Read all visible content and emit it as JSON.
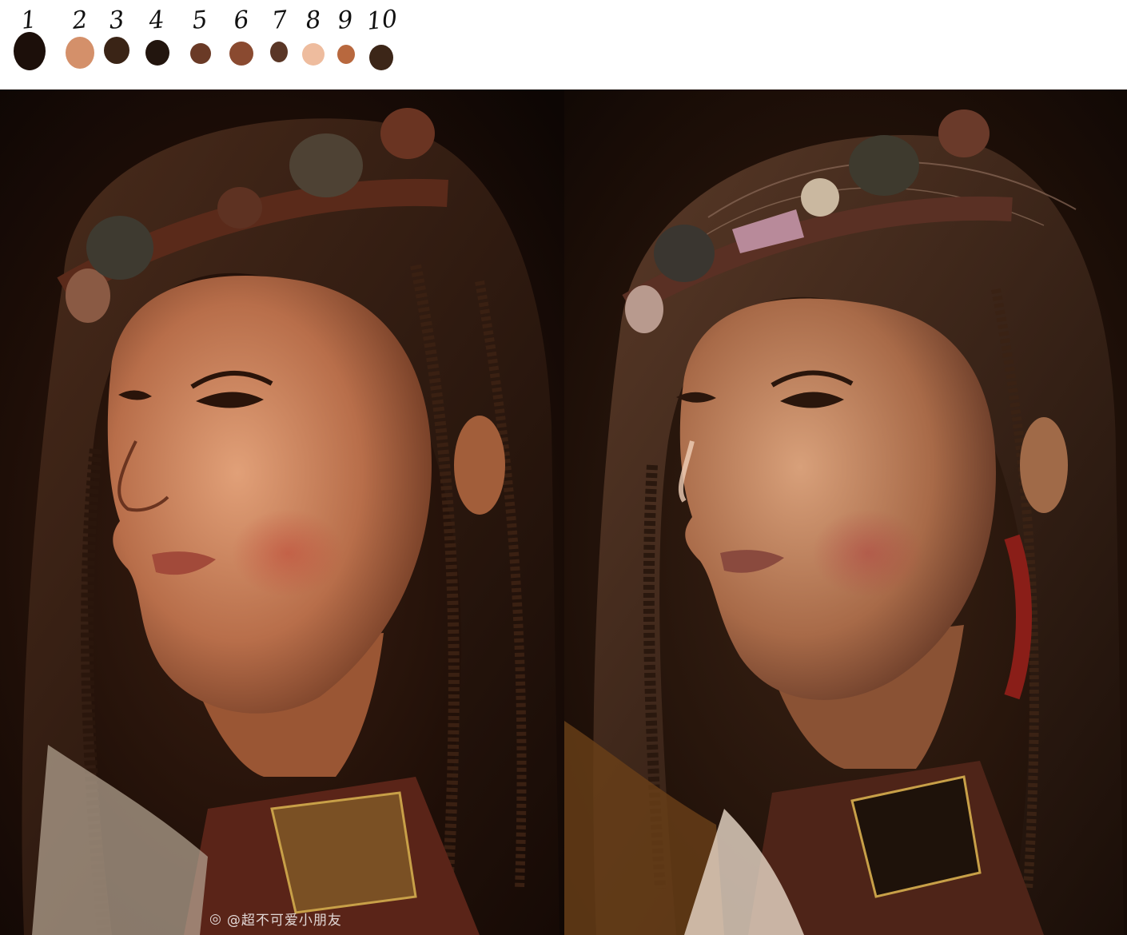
{
  "palette": {
    "swatches": [
      {
        "label": "1",
        "color": "#1c0f0a"
      },
      {
        "label": "2",
        "color": "#d4906a"
      },
      {
        "label": "3",
        "color": "#3a2416"
      },
      {
        "label": "4",
        "color": "#22150e"
      },
      {
        "label": "5",
        "color": "#6a3a26"
      },
      {
        "label": "6",
        "color": "#8a4a30"
      },
      {
        "label": "7",
        "color": "#5a3626"
      },
      {
        "label": "8",
        "color": "#eebc9e"
      },
      {
        "label": "9",
        "color": "#b8683e"
      },
      {
        "label": "10",
        "color": "#3c2618"
      }
    ]
  },
  "photo": {
    "watermark": "@超不可爱小朋友",
    "watermark_icon": "weibo-icon"
  },
  "painting": {}
}
